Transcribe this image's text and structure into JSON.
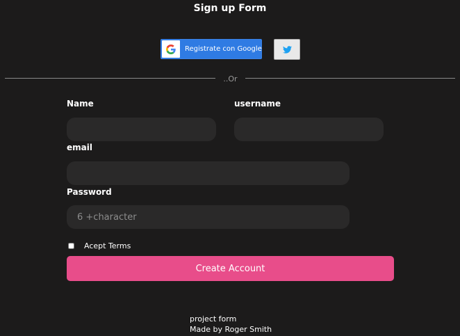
{
  "form": {
    "title": "Sign up Form",
    "google_button_label": "Registrate con Google",
    "divider_text": "..Or",
    "fields": {
      "name": {
        "label": "Name",
        "value": "",
        "placeholder": ""
      },
      "username": {
        "label": "username",
        "value": "",
        "placeholder": ""
      },
      "email": {
        "label": "email",
        "value": "",
        "placeholder": ""
      },
      "password": {
        "label": "Password",
        "value": "",
        "placeholder": "6 +character"
      }
    },
    "terms_label": "Acept Terms",
    "terms_checked": false,
    "submit_label": "Create Account"
  },
  "footer": {
    "line1": "project form",
    "line2": "Made by Roger Smith"
  },
  "colors": {
    "background": "#1c1b1b",
    "google_blue": "#2f7be3",
    "twitter_blue": "#1da1f2",
    "accent_pink": "#e84d8a",
    "input_bg": "#2a2929"
  },
  "icons": {
    "google": "google-icon",
    "twitter": "twitter-bird-icon"
  }
}
